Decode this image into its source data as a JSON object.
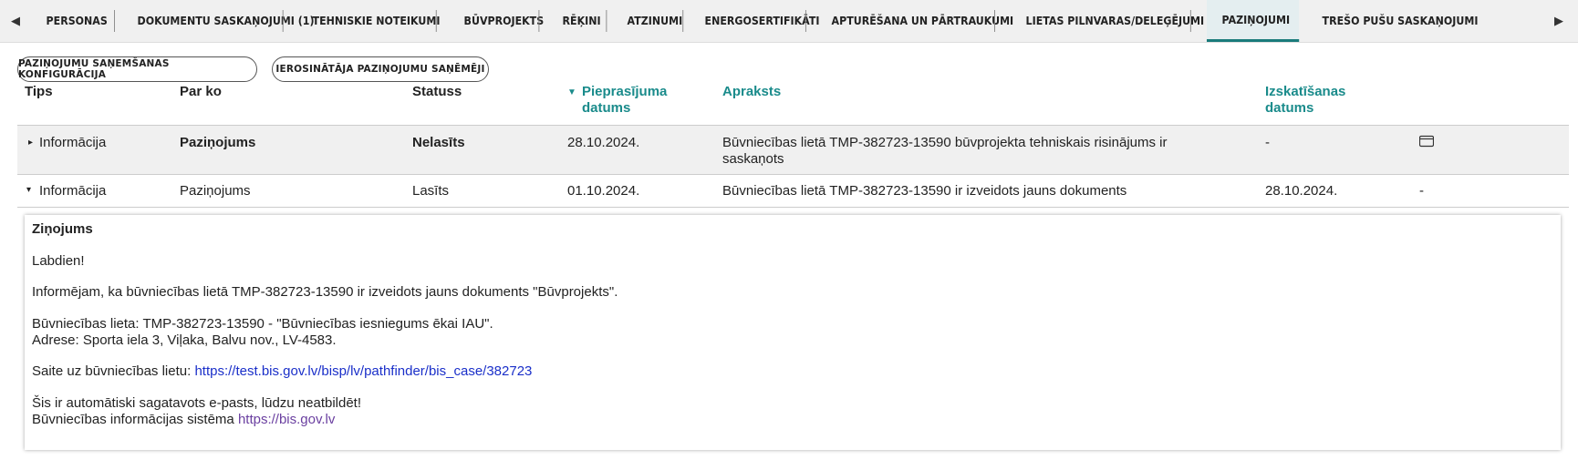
{
  "tabs": [
    {
      "label": "PERSONAS"
    },
    {
      "label": "DOKUMENTU SASKAŅOJUMI (1)"
    },
    {
      "label": "TEHNISKIE NOTEIKUMI"
    },
    {
      "label": "BŪVPROJEKTS"
    },
    {
      "label": "RĒĶINI"
    },
    {
      "label": "ATZINUMI"
    },
    {
      "label": "ENERGOSERTIFIKĀTI"
    },
    {
      "label": "APTURĒŠANA UN PĀRTRAUKUMI"
    },
    {
      "label": "LIETAS PILNVARAS/DELEĢĒJUMI"
    },
    {
      "label": "PAZIŅOJUMI",
      "active": true
    },
    {
      "label": "TREŠO PUŠU SASKAŅOJUMI"
    }
  ],
  "nav": {
    "prev": "◀",
    "next": "▶"
  },
  "buttons": {
    "config": "PAZIŅOJUMU SAŅEMŠANAS KONFIGURĀCIJA",
    "initiator": "IEROSINĀTĀJA PAZIŅOJUMU SAŅĒMĒJI"
  },
  "table": {
    "headers": {
      "tips": "Tips",
      "parko": "Par ko",
      "statuss": "Statuss",
      "pieprasijums": "Pieprasījuma datums",
      "apraksts": "Apraksts",
      "izskatisanas": "Izskatīšanas datums"
    },
    "sort_indicator": "▼",
    "rows": [
      {
        "toggle": "▸",
        "tips": "Informācija",
        "parko": "Paziņojums",
        "statuss": "Nelasīts",
        "datums": "28.10.2024.",
        "apraksts": "Būvniecības lietā TMP-382723-13590 būvprojekta tehniskais risinājums ir saskaņots",
        "izskatisanas": "-",
        "action_icon": "envelope-icon"
      },
      {
        "toggle": "▾",
        "tips": "Informācija",
        "parko": "Paziņojums",
        "statuss": "Lasīts",
        "datums": "01.10.2024.",
        "apraksts": "Būvniecības lietā TMP-382723-13590 ir izveidots jauns dokuments",
        "izskatisanas": "28.10.2024.",
        "action": "-"
      }
    ]
  },
  "message": {
    "title": "Ziņojums",
    "greeting": "Labdien!",
    "line1": "Informējam, ka būvniecības lietā TMP-382723-13590 ir izveidots jauns dokuments \"Būvprojekts\".",
    "case_line": "Būvniecības lieta: TMP-382723-13590 - \"Būvniecības iesniegums ēkai IAU\".",
    "address_line": "Adrese: Sporta iela 3, Viļaka, Balvu nov., LV-4583.",
    "link_prefix": "Saite uz būvniecības lietu: ",
    "link_text": "https://test.bis.gov.lv/bisp/lv/pathfinder/bis_case/382723",
    "auto_line": "Šis ir automātiski sagatavots e-pasts, lūdzu neatbildēt!",
    "system_prefix": "Būvniecības informācijas sistēma ",
    "system_link": "https://bis.gov.lv"
  },
  "colors": {
    "accent": "#1a8b8b",
    "link": "#1a2fc9",
    "visited_link": "#6a3fa0"
  }
}
